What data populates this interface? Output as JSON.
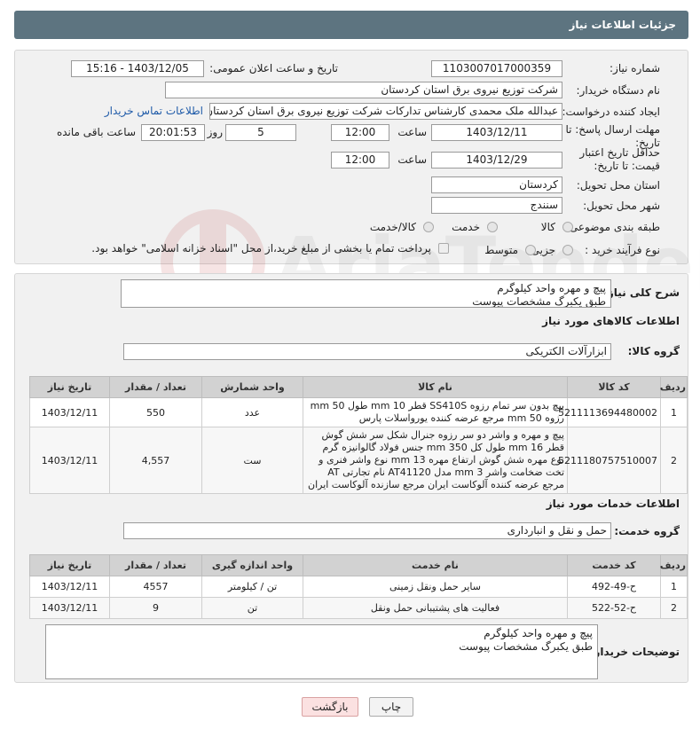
{
  "header": {
    "title": "جزئیات اطلاعات نیاز"
  },
  "labels": {
    "need_number": "شماره نیاز:",
    "announce_datetime": "تاریخ و ساعت اعلان عمومی:",
    "buyer_org": "نام دستگاه خریدار:",
    "requester": "ایجاد کننده درخواست:",
    "reply_deadline": "مهلت ارسال پاسخ: تا تاریخ:",
    "time": "ساعت",
    "day_and": "روز و",
    "hours_left": "ساعت باقی مانده",
    "price_validity": "حداقل تاریخ اعتبار قیمت: تا تاریخ:",
    "delivery_province": "استان محل تحویل:",
    "delivery_city": "شهر محل تحویل:",
    "category": "طبقه بندی موضوعی:",
    "purchase_type": "نوع فرآیند خرید :",
    "general_desc": "شرح کلی نیاز:",
    "goods_info": "اطلاعات کالاهای مورد نیاز",
    "goods_group": "گروه کالا:",
    "services_info": "اطلاعات خدمات مورد نیاز",
    "service_group": "گروه خدمت:",
    "buyer_notes": "توضیحات خریدار:"
  },
  "fields": {
    "need_number": "1103007017000359",
    "announce_datetime": "1403/12/05 - 15:16",
    "buyer_org": "شرکت توزیع نیروی برق استان کردستان",
    "requester": "عبدالله ملک محمدی کارشناس تدارکات شرکت توزیع نیروی برق استان کردستان",
    "contact_link": "اطلاعات تماس خریدار",
    "reply_date": "1403/12/11",
    "reply_time": "12:00",
    "reply_days": "5",
    "reply_remaining": "20:01:53",
    "validity_date": "1403/12/29",
    "validity_time": "12:00",
    "province": "کردستان",
    "city": "سنندج",
    "general_desc": "پیچ و مهره واحد کیلوگرم\nطبق یکبرگ مشخصات پیوست",
    "goods_group": "ابزارآلات الکتریکی",
    "service_group": "حمل و نقل و انبارداری",
    "buyer_notes": "پیچ و مهره واحد کیلوگرم\nطبق یکبرگ مشخصات پیوست"
  },
  "category_options": [
    "کالا",
    "خدمت",
    "کالا/خدمت"
  ],
  "purchase_options": [
    "جزیی",
    "متوسط"
  ],
  "purchase_note": "پرداخت تمام یا بخشی از مبلغ خرید،از محل \"اسناد خزانه اسلامی\" خواهد بود.",
  "goods_table": {
    "headers": [
      "ردیف",
      "کد کالا",
      "نام کالا",
      "واحد شمارش",
      "تعداد / مقدار",
      "تاریخ نیاز"
    ],
    "rows": [
      [
        "1",
        "5211113694480002",
        "پیچ بدون سر تمام رزوه SS410S قطر 10 mm طول 50 mm رزوه 50 mm مرجع عرضه کننده یورواسلات پارس",
        "عدد",
        "550",
        "1403/12/11"
      ],
      [
        "2",
        "5211180757510007",
        "پیچ و مهره و واشر دو سر رزوه جنرال شکل سر شش گوش قطر 16 mm طول کل 350 mm جنس فولاد گالوانیزه گرم نوع مهره شش گوش ارتفاع مهره 13 mm نوع واشر فنری و تخت ضخامت واشر 3 mm مدل AT41120 نام تجارتی AT مرجع عرضه کننده آلوکاست ایران مرجع سازنده آلوکاست ایران",
        "ست",
        "4,557",
        "1403/12/11"
      ]
    ]
  },
  "services_table": {
    "headers": [
      "ردیف",
      "کد خدمت",
      "نام خدمت",
      "واحد اندازه گیری",
      "تعداد / مقدار",
      "تاریخ نیاز"
    ],
    "rows": [
      [
        "1",
        "ح-49-492",
        "سایر حمل ونقل زمینی",
        "تن / کیلومتر",
        "4557",
        "1403/12/11"
      ],
      [
        "2",
        "ح-52-522",
        "فعالیت های پشتیبانی حمل ونقل",
        "تن",
        "9",
        "1403/12/11"
      ]
    ]
  },
  "buttons": {
    "print": "چاپ",
    "back": "بازگشت"
  },
  "colors": {
    "header": "#5d7480",
    "link": "#1e5aa8",
    "back_button_bg": "#fbe1e1"
  }
}
